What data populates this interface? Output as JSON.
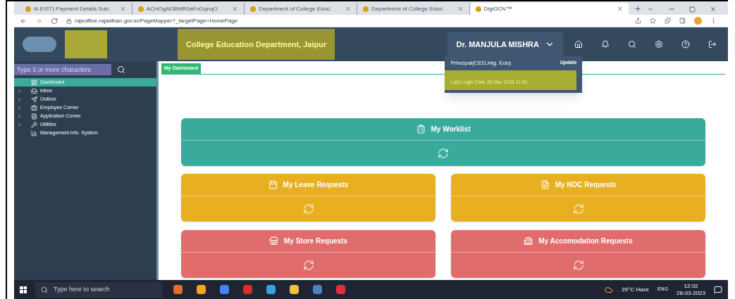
{
  "browser": {
    "tabs": [
      {
        "title": "N-EIST) Payment Details Sub:",
        "selected": false
      },
      {
        "title": "ACHOgAOBMR0aFnGqnqO",
        "selected": false
      },
      {
        "title": "Department of College Educ:",
        "selected": false
      },
      {
        "title": "Department of College Educ:",
        "selected": false
      },
      {
        "title": "DigiGOV™",
        "selected": true
      }
    ],
    "url": "rajeoffice.rajasthan.gov.in/PageMapper?_targetPage=HomePage"
  },
  "app": {
    "header_title": "College Education Department, Jaipur",
    "search": {
      "placeholder": "Type 3 or more characters"
    },
    "user": {
      "name": "Dr. MANJULA MISHRA",
      "role": "Principal(CED,Hig. Edu)",
      "update": "Update",
      "last_login": "Last Login Date 28 Mar 2023 11:01"
    },
    "sidebar": {
      "items": [
        {
          "label": "Dashboard",
          "expandable": false,
          "selected": true
        },
        {
          "label": "Inbox",
          "expandable": true,
          "selected": false
        },
        {
          "label": "Outbox",
          "expandable": true,
          "selected": false
        },
        {
          "label": "Employee Corner",
          "expandable": true,
          "selected": false
        },
        {
          "label": "Application Corner",
          "expandable": true,
          "selected": false
        },
        {
          "label": "Utilities",
          "expandable": true,
          "selected": false
        },
        {
          "label": "Management Info. System",
          "expandable": false,
          "selected": false
        }
      ]
    },
    "breadcrumb": "My Dashboard",
    "cards": [
      {
        "title": "My Worklist",
        "color": "#3aaa9c"
      },
      {
        "title": "My Leave Requests",
        "color": "#e8b020"
      },
      {
        "title": "My NOC Requests",
        "color": "#e8b020"
      },
      {
        "title": "My Store Requests",
        "color": "#e06c6c"
      },
      {
        "title": "My Accomodation Requests",
        "color": "#e06c6c"
      }
    ]
  },
  "taskbar": {
    "search_placeholder": "Type here to search",
    "weather": "29°C Haze",
    "language": "ENG",
    "time": "12:02",
    "date": "28-03-2023"
  }
}
